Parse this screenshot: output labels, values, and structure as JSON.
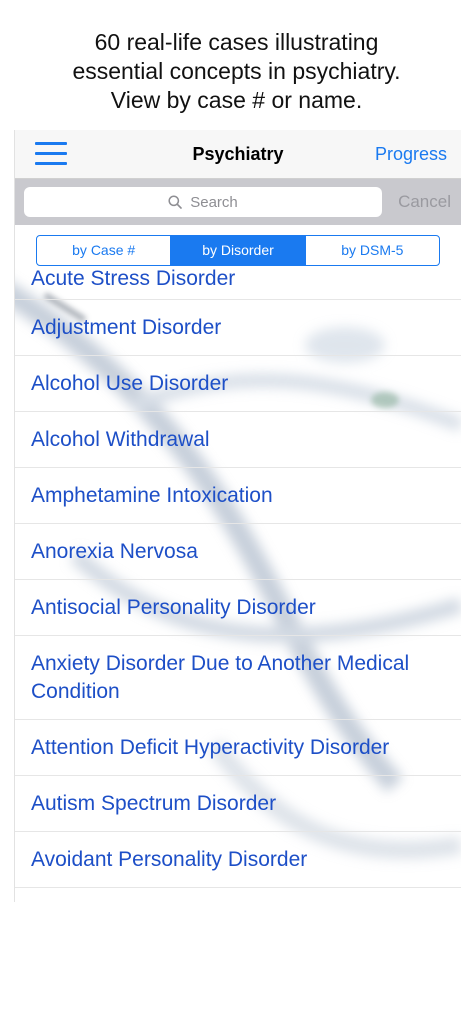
{
  "caption": {
    "line1": "60 real-life cases illustrating",
    "line2": "essential concepts in psychiatry.",
    "line3": "View by case # or name."
  },
  "navbar": {
    "title": "Psychiatry",
    "progress_label": "Progress",
    "menu_icon": "hamburger-menu-icon"
  },
  "search": {
    "placeholder": "Search",
    "cancel_label": "Cancel",
    "icon": "search-icon"
  },
  "segments": {
    "by_case": "by Case #",
    "by_disorder": "by Disorder",
    "by_dsm": "by DSM-5",
    "selected": "by Disorder"
  },
  "disorders": [
    "Acute Stress Disorder",
    "Adjustment Disorder",
    "Alcohol Use Disorder",
    "Alcohol Withdrawal",
    "Amphetamine Intoxication",
    "Anorexia Nervosa",
    "Antisocial Personality Disorder",
    "Anxiety Disorder Due to Another Medical Condition",
    "Attention Deficit Hyperactivity Disorder",
    "Autism Spectrum Disorder",
    "Avoidant Personality Disorder"
  ],
  "colors": {
    "accent": "#1a7af0",
    "list_text": "#1d4fc7",
    "search_bar_bg": "#c9c9ce"
  }
}
